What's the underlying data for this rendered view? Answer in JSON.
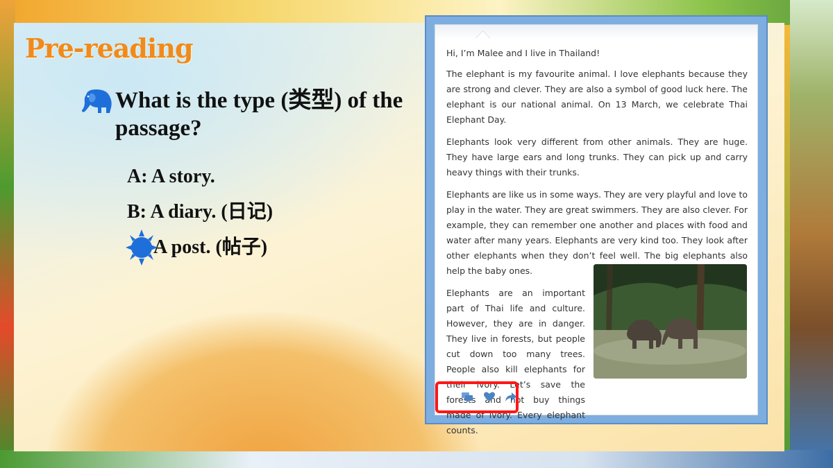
{
  "slide": {
    "title": "Pre-reading",
    "question": "What is the type (类型) of the passage?",
    "options": [
      {
        "label": "A: A story."
      },
      {
        "label": "B: A diary. (日记)"
      },
      {
        "label": "A post. (帖子)"
      }
    ]
  },
  "passage": {
    "greeting": "Hi, I’m Malee and I live in Thailand!",
    "paragraphs": [
      "The elephant is my favourite animal. I love elephants because they are strong and clever. They are also a symbol of good luck here. The elephant is our national animal. On 13 March, we celebrate Thai Elephant Day.",
      "Elephants look very different from other animals. They are huge. They have large ears and long trunks. They can pick up and carry heavy things with their trunks.",
      "Elephants are like us in some ways. They are very playful and love to play in the water. They are great swimmers. They are also clever. For example, they can remember one another and places with food and water after many years. Elephants are very kind too. They look after other elephants when they don’t feel well. The big elephants also help the baby ones.",
      "Elephants are an important part of Thai life and culture. However, they are in danger. They live in forests, but people cut down too many trees. People also kill elephants for their ivory. Let’s save the forests and not buy things made of ivory. Every elephant counts."
    ],
    "actions": [
      "comment-icon",
      "heart-icon",
      "share-icon"
    ]
  },
  "colors": {
    "title": "#f08a1c",
    "icon_blue": "#1e6fd9",
    "highlight_red": "#ff1616"
  }
}
